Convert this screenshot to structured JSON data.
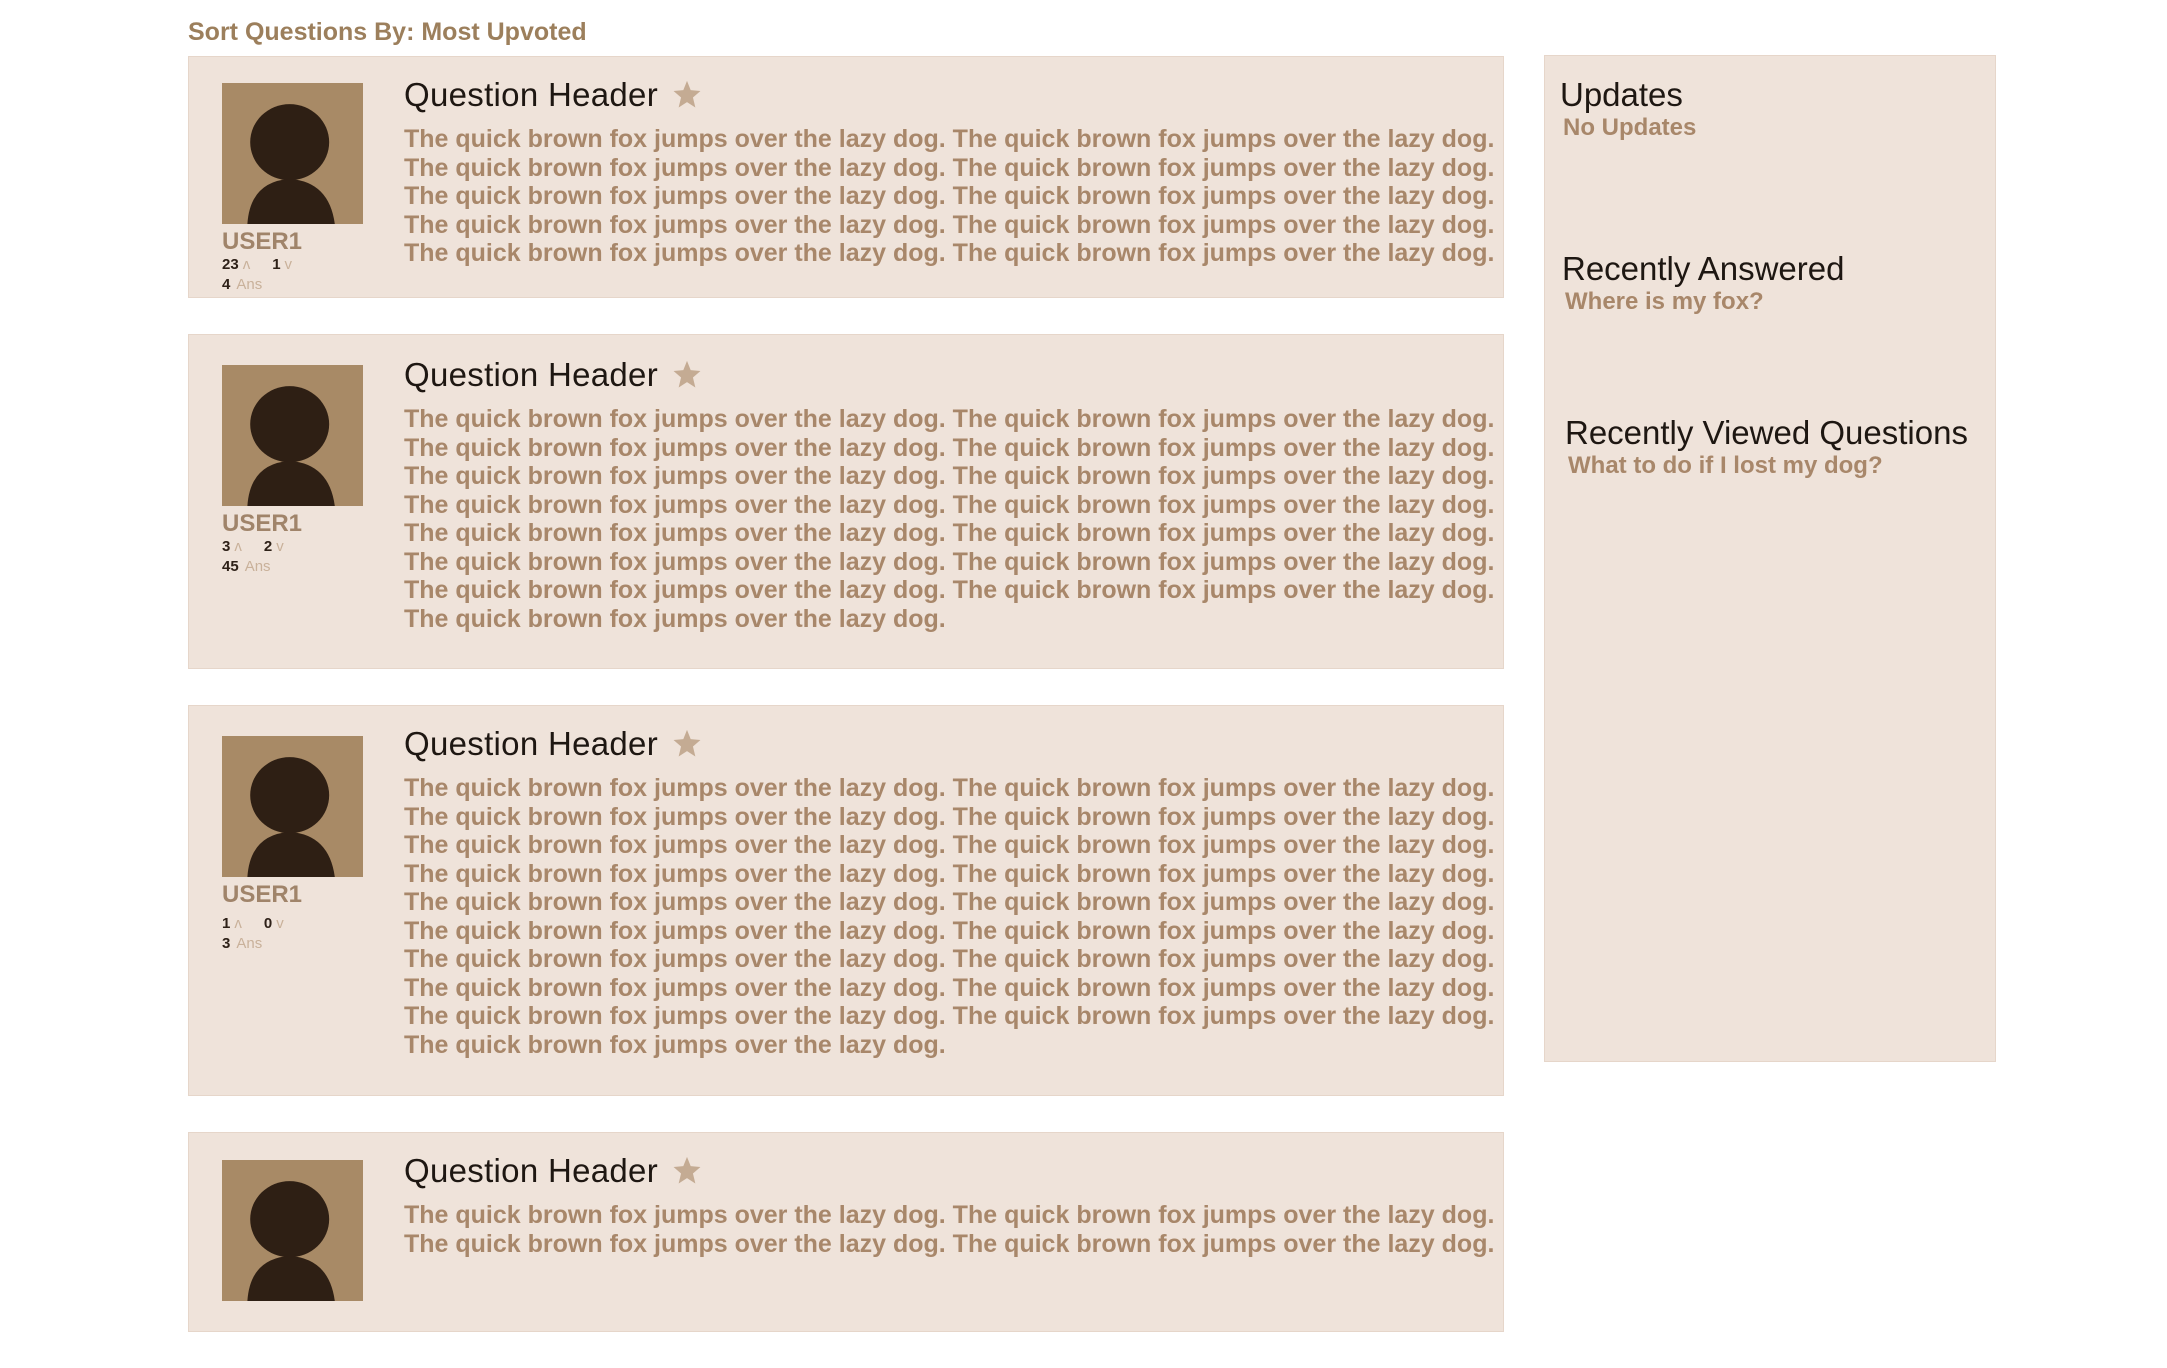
{
  "sort": {
    "label": "Sort Questions By: Most Upvoted"
  },
  "icons": {
    "avatar": "user-silhouette-icon",
    "star": "star-icon",
    "upvote": "chevron-up-icon",
    "downvote": "chevron-down-icon"
  },
  "colors": {
    "card_bg": "#efe3da",
    "accent_text": "#a8876a",
    "header_text": "#1e1712",
    "avatar_bg": "#a88a66",
    "silhouette": "#2e1f14",
    "star": "#c4ab93"
  },
  "questions": [
    {
      "title": "Question Header",
      "user": "USER1",
      "upvotes": "23",
      "downvotes": "1",
      "answers": "4",
      "ans_label": "Ans",
      "up_glyph": "ʌ",
      "down_glyph": "v",
      "lines": [
        "The quick brown fox jumps over the lazy dog. The quick brown fox jumps over the lazy dog.",
        "The quick brown fox jumps over the lazy dog. The quick brown fox jumps over the lazy dog.",
        "The quick brown fox jumps over the lazy dog. The quick brown fox jumps over the lazy dog.",
        "The quick brown fox jumps over the lazy dog. The quick brown fox jumps over the lazy dog.",
        "The quick brown fox jumps over the lazy dog. The quick brown fox jumps over the lazy dog."
      ]
    },
    {
      "title": "Question Header",
      "user": "USER1",
      "upvotes": "3",
      "downvotes": "2",
      "answers": "45",
      "ans_label": "Ans",
      "up_glyph": "ʌ",
      "down_glyph": "v",
      "lines": [
        "The quick brown fox jumps over the lazy dog. The quick brown fox jumps over the lazy dog.",
        "The quick brown fox jumps over the lazy dog. The quick brown fox jumps over the lazy dog.",
        "The quick brown fox jumps over the lazy dog. The quick brown fox jumps over the lazy dog.",
        "The quick brown fox jumps over the lazy dog. The quick brown fox jumps over the lazy dog.",
        "The quick brown fox jumps over the lazy dog. The quick brown fox jumps over the lazy dog.",
        "The quick brown fox jumps over the lazy dog. The quick brown fox jumps over the lazy dog.",
        "The quick brown fox jumps over the lazy dog. The quick brown fox jumps over the lazy dog.",
        "The quick brown fox jumps over the lazy dog."
      ]
    },
    {
      "title": "Question Header",
      "user": "USER1",
      "upvotes": "1",
      "downvotes": "0",
      "answers": "3",
      "ans_label": "Ans",
      "up_glyph": "ʌ",
      "down_glyph": "v",
      "lines": [
        "The quick brown fox jumps over the lazy dog. The quick brown fox jumps over the lazy dog.",
        "The quick brown fox jumps over the lazy dog. The quick brown fox jumps over the lazy dog.",
        "The quick brown fox jumps over the lazy dog. The quick brown fox jumps over the lazy dog.",
        "The quick brown fox jumps over the lazy dog. The quick brown fox jumps over the lazy dog.",
        "The quick brown fox jumps over the lazy dog. The quick brown fox jumps over the lazy dog.",
        "The quick brown fox jumps over the lazy dog. The quick brown fox jumps over the lazy dog.",
        "The quick brown fox jumps over the lazy dog. The quick brown fox jumps over the lazy dog.",
        "The quick brown fox jumps over the lazy dog. The quick brown fox jumps over the lazy dog.",
        "The quick brown fox jumps over the lazy dog. The quick brown fox jumps over the lazy dog.",
        "The quick brown fox jumps over the lazy dog."
      ]
    },
    {
      "title": "Question Header",
      "lines": [
        "The quick brown fox jumps over the lazy dog. The quick brown fox jumps over the lazy dog.",
        "The quick brown fox jumps over the lazy dog. The quick brown fox jumps over the lazy dog."
      ]
    }
  ],
  "sidebar": {
    "updates": {
      "title": "Updates",
      "text": "No Updates"
    },
    "recently_answered": {
      "title": "Recently Answered",
      "item": "Where is my fox?"
    },
    "recently_viewed": {
      "title": "Recently Viewed Questions",
      "item": "What to do if I lost my dog?"
    }
  }
}
